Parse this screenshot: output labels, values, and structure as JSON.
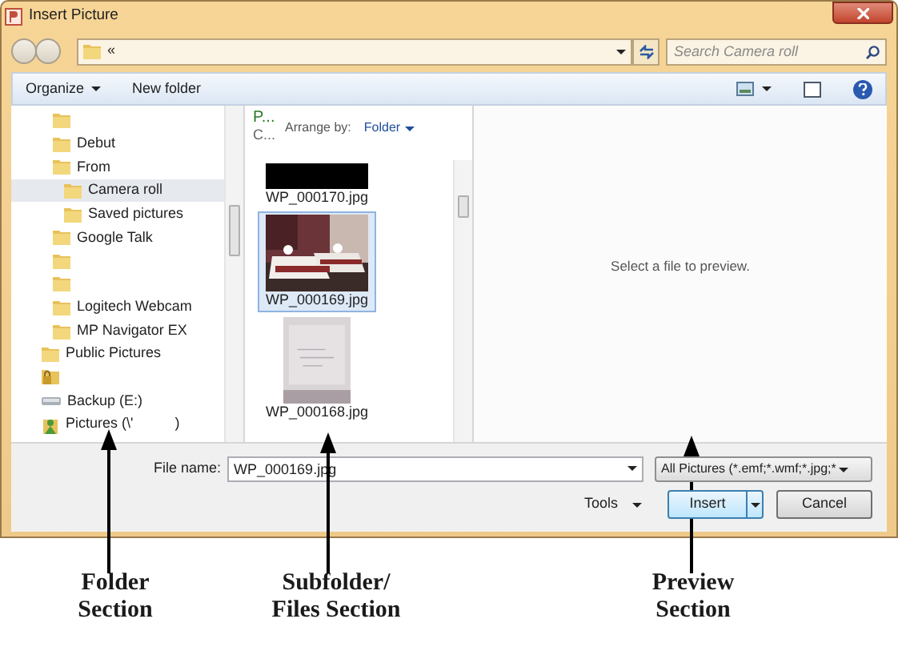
{
  "window": {
    "title": "Insert Picture"
  },
  "address_bar": {
    "path": "«"
  },
  "search": {
    "placeholder": "Search Camera roll"
  },
  "toolbar": {
    "buttons": [
      {
        "label": "Organize",
        "dropdown": true
      },
      {
        "label": "New folder",
        "dropdown": false
      }
    ]
  },
  "folder_tree": [
    {
      "children": [
        {
          "kind": "folder"
        },
        {
          "kind": "folder",
          "label": "Debut"
        },
        {
          "kind": "folder",
          "label": "From",
          "children": [
            {
              "kind": "folder",
              "label": "Camera roll",
              "selected": true
            },
            {
              "kind": "folder",
              "label": "Saved pictures",
              "selected": false
            }
          ]
        },
        {
          "kind": "folder",
          "label": "Google Talk"
        },
        {
          "kind": "folder"
        },
        {
          "kind": "folder"
        },
        {
          "kind": "folder",
          "label": "Logitech Webcam"
        },
        {
          "kind": "folder",
          "label": "MP Navigator EX"
        }
      ]
    },
    {
      "kind": "folder",
      "label": "Public Pictures"
    },
    {
      "kind": "locked"
    },
    {
      "kind": "drive",
      "label": "Backup (E:)"
    },
    {
      "kind": "library",
      "label": "Pictures (\\'",
      "label_end": ")"
    }
  ],
  "files_header": {
    "library_title": "P...",
    "library_subtitle": "C...",
    "arrange_label": "Arrange by:",
    "arrange_value": "Folder"
  },
  "files": [
    {
      "name": "WP_000170.jpg",
      "kind": "redacted",
      "selected": false
    },
    {
      "name": "WP_000169.jpg",
      "kind": "picture",
      "selected": true
    },
    {
      "name": "WP_000168.jpg",
      "kind": "picture",
      "selected": false
    }
  ],
  "preview": {
    "message": "Select a file to preview."
  },
  "file_name": {
    "label": "File name:",
    "value": "WP_000169.jpg"
  },
  "file_type": {
    "value": "All Pictures (*.emf;*.wmf;*.jpg;*"
  },
  "buttons": {
    "tools": "Tools",
    "insert": "Insert",
    "cancel": "Cancel"
  },
  "annotations": [
    {
      "lines": [
        "Folder",
        "Section"
      ]
    },
    {
      "lines": [
        "Subfolder/",
        "Files Section"
      ]
    },
    {
      "lines": [
        "Preview",
        "Section"
      ]
    }
  ]
}
